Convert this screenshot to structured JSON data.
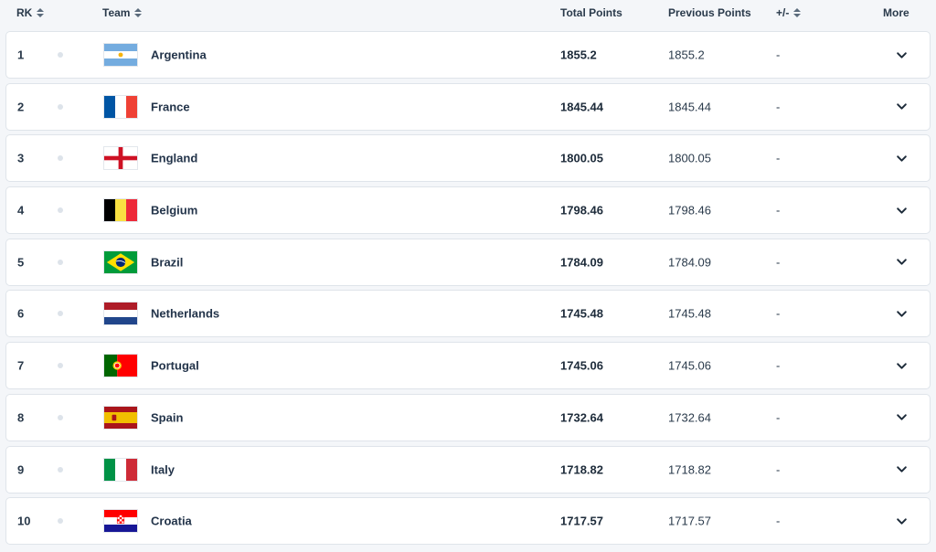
{
  "header": {
    "rk": "RK",
    "team": "Team",
    "total_points": "Total Points",
    "previous_points": "Previous Points",
    "change": "+/-",
    "more": "More"
  },
  "rows": [
    {
      "rk": "1",
      "team": "Argentina",
      "flag": "argentina-flag",
      "total": "1855.2",
      "previous": "1855.2",
      "change": "-"
    },
    {
      "rk": "2",
      "team": "France",
      "flag": "france-flag",
      "total": "1845.44",
      "previous": "1845.44",
      "change": "-"
    },
    {
      "rk": "3",
      "team": "England",
      "flag": "england-flag",
      "total": "1800.05",
      "previous": "1800.05",
      "change": "-"
    },
    {
      "rk": "4",
      "team": "Belgium",
      "flag": "belgium-flag",
      "total": "1798.46",
      "previous": "1798.46",
      "change": "-"
    },
    {
      "rk": "5",
      "team": "Brazil",
      "flag": "brazil-flag",
      "total": "1784.09",
      "previous": "1784.09",
      "change": "-"
    },
    {
      "rk": "6",
      "team": "Netherlands",
      "flag": "netherlands-flag",
      "total": "1745.48",
      "previous": "1745.48",
      "change": "-"
    },
    {
      "rk": "7",
      "team": "Portugal",
      "flag": "portugal-flag",
      "total": "1745.06",
      "previous": "1745.06",
      "change": "-"
    },
    {
      "rk": "8",
      "team": "Spain",
      "flag": "spain-flag",
      "total": "1732.64",
      "previous": "1732.64",
      "change": "-"
    },
    {
      "rk": "9",
      "team": "Italy",
      "flag": "italy-flag",
      "total": "1718.82",
      "previous": "1718.82",
      "change": "-"
    },
    {
      "rk": "10",
      "team": "Croatia",
      "flag": "croatia-flag",
      "total": "1717.57",
      "previous": "1717.57",
      "change": "-"
    }
  ]
}
